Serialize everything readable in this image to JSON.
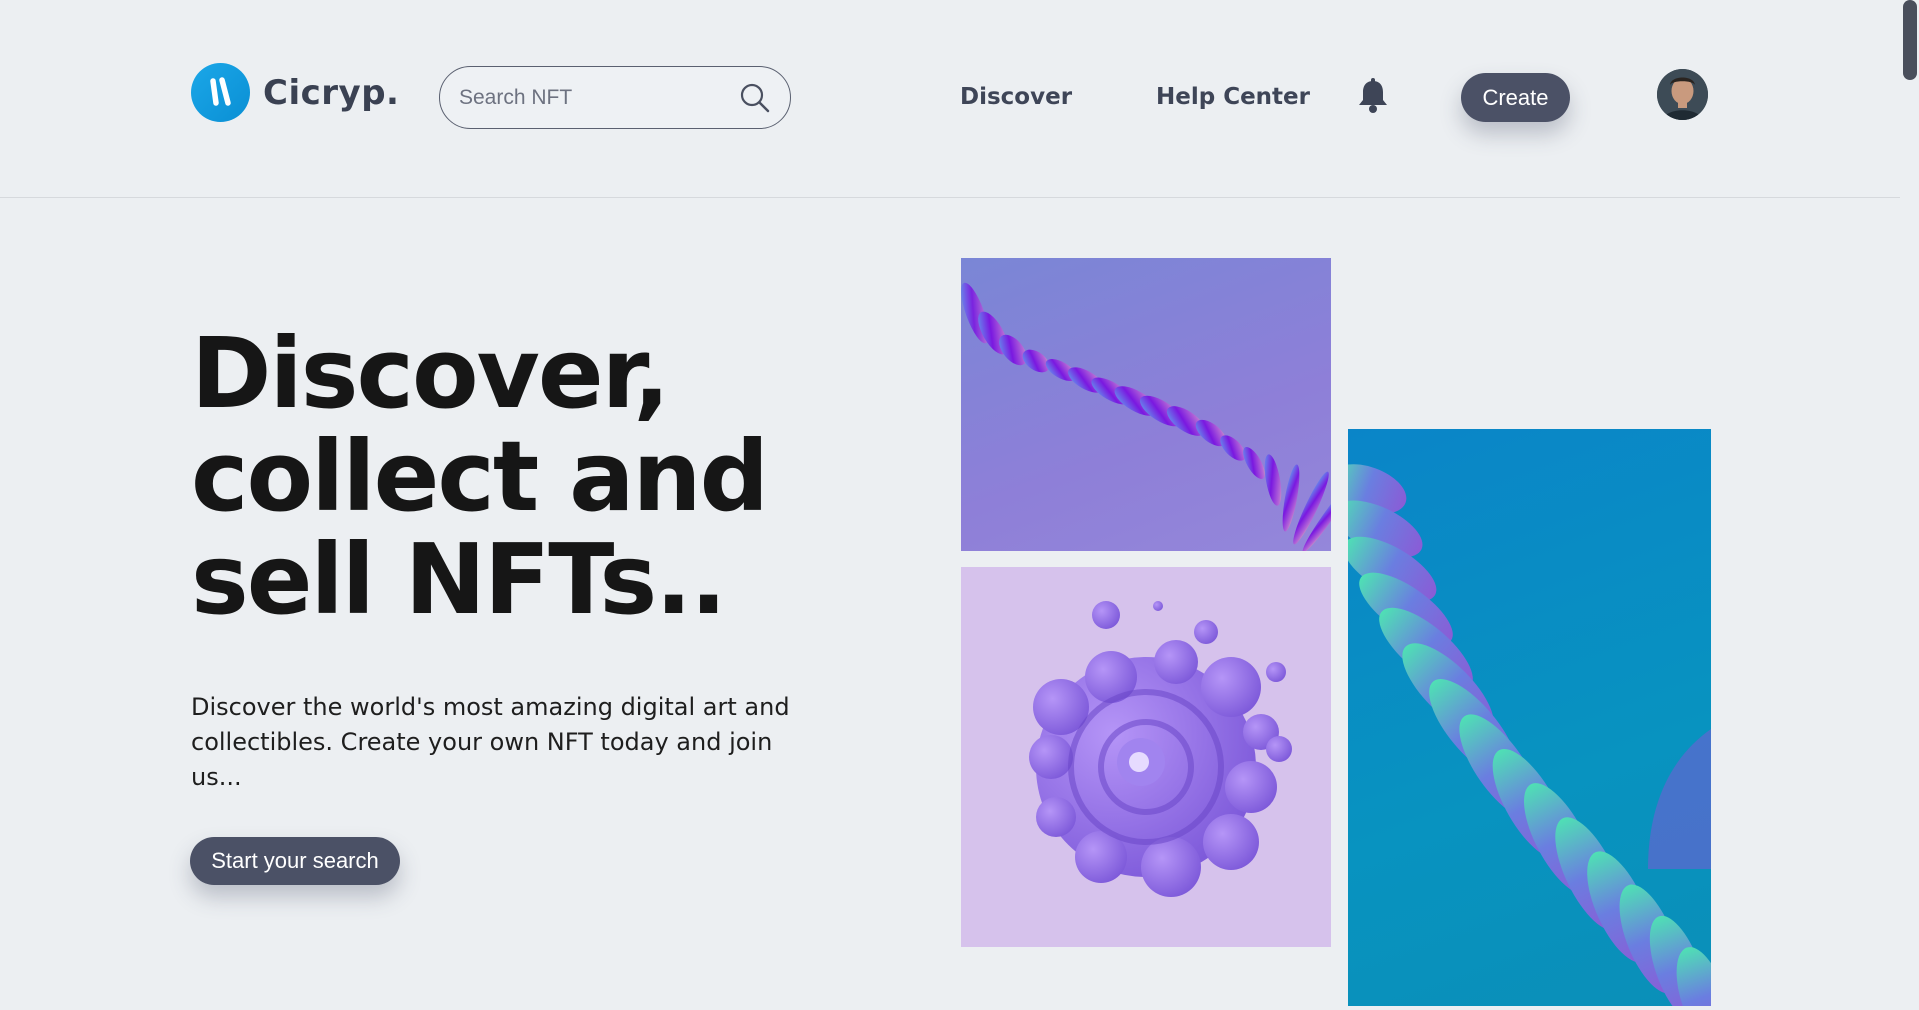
{
  "header": {
    "logo_text": "Cicryp.",
    "search": {
      "placeholder": "Search NFT",
      "value": ""
    },
    "nav": [
      {
        "label": "Discover"
      },
      {
        "label": "Help Center"
      }
    ],
    "create_label": "Create"
  },
  "hero": {
    "headline_lines": [
      "Discover,",
      "collect and",
      "sell NFTs.."
    ],
    "subtext": "Discover the world's most amazing digital art and collectibles. Create your own NFT today and join us...",
    "cta_label": "Start your search"
  },
  "icons": {
    "logo": "logo-icon",
    "search": "search-icon",
    "notifications": "bell-icon",
    "avatar": "user-avatar"
  },
  "colors": {
    "background": "#eceff2",
    "button": "#4b5166",
    "logo_accent": "#1ba7e8",
    "headline": "#161616",
    "nav_text": "#3e4557"
  }
}
